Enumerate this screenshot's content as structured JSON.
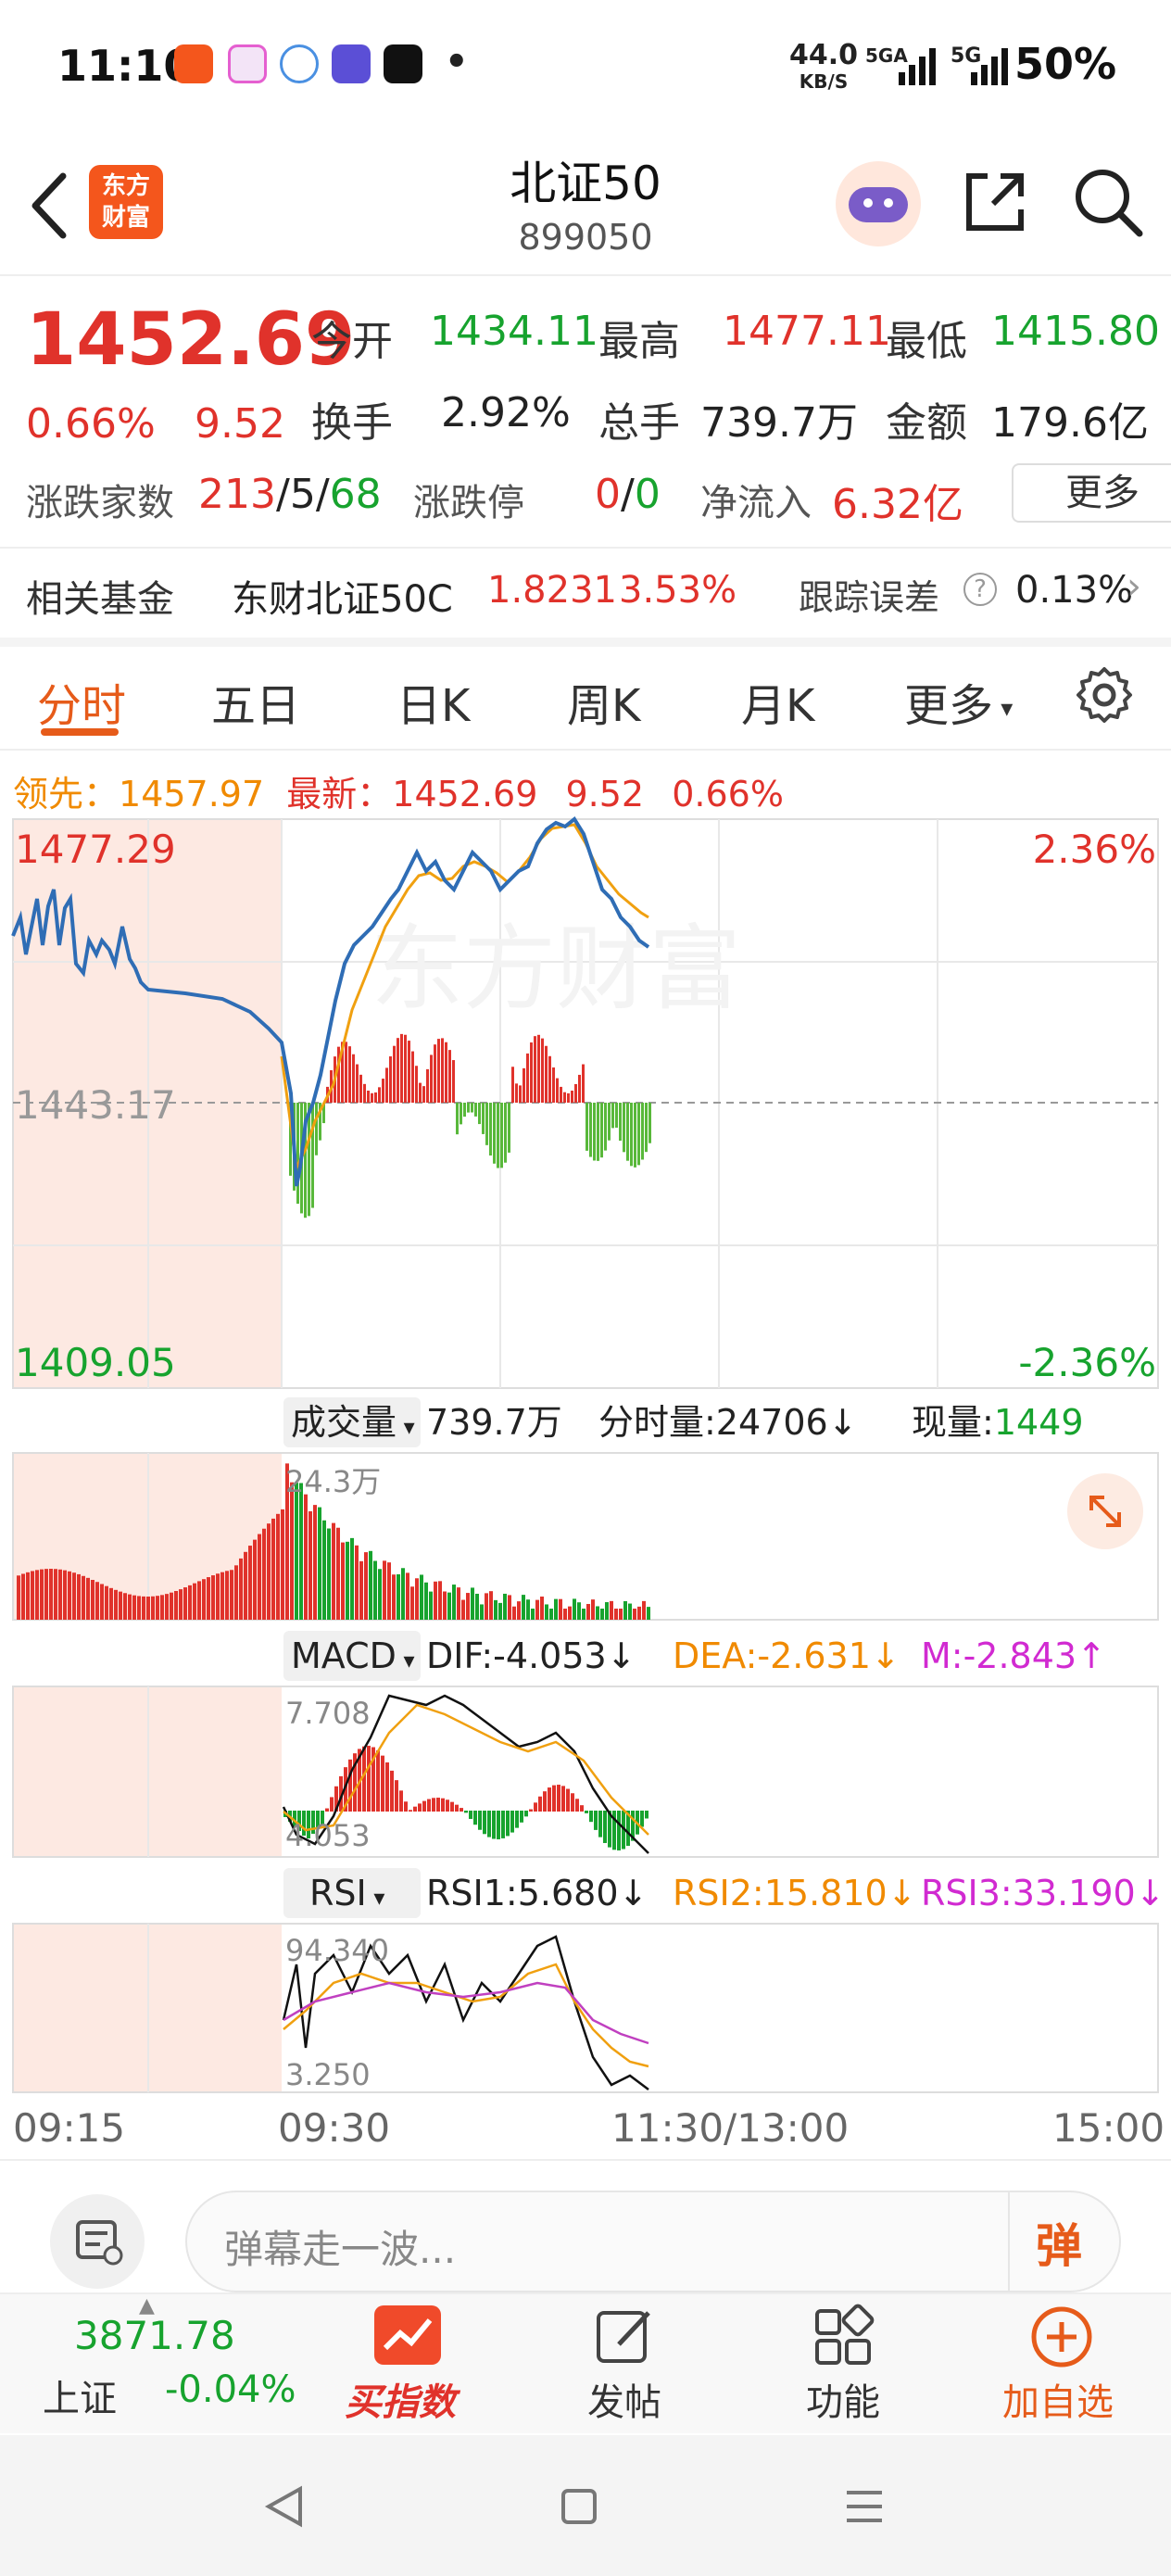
{
  "status_bar": {
    "time": "11:10",
    "net_speed": "44.0",
    "net_unit": "KB/S",
    "sig1": "5GA",
    "sig2": "5G",
    "battery": "50%",
    "dot": "•"
  },
  "header": {
    "title": "北证50",
    "code": "899050",
    "logo_line1": "东方",
    "logo_line2": "财富"
  },
  "quote": {
    "price": "1452.69",
    "pct": "0.66%",
    "change": "9.52",
    "open_label": "今开",
    "open": "1434.11",
    "high_label": "最高",
    "high": "1477.11",
    "low_label": "最低",
    "low": "1415.80",
    "turnover_label": "换手",
    "turnover": "2.92%",
    "volume_label": "总手",
    "volume": "739.7万",
    "amount_label": "金额",
    "amount": "179.6亿",
    "breadth_label": "涨跌家数",
    "breadth_up": "213",
    "breadth_sep1": "/",
    "breadth_flat": "5",
    "breadth_sep2": "/",
    "breadth_down": "68",
    "limit_label": "涨跌停",
    "limit_up": "0",
    "limit_sep": "/",
    "limit_down": "0",
    "inflow_label": "净流入",
    "inflow": "6.32亿",
    "more_label": "更多"
  },
  "fund": {
    "label": "相关基金",
    "name": "东财北证50C",
    "nav": "1.8231",
    "pct": "3.53%",
    "track_label": "跟踪误差",
    "track_value": "0.13%"
  },
  "tabs": [
    "分时",
    "五日",
    "日K",
    "周K",
    "月K",
    "更多"
  ],
  "lead": {
    "lead_label": "领先：",
    "lead_value": "1457.97",
    "latest_label": "最新：",
    "latest_value": "1452.69",
    "change": "9.52",
    "pct": "0.66%"
  },
  "chart": {
    "top_price": "1477.29",
    "mid_price": "1443.17",
    "bottom_price": "1409.05",
    "top_pct": "2.36%",
    "bottom_pct": "-2.36%",
    "watermark": "东方财富",
    "volume_label": "成交量",
    "volume_total": "739.7万",
    "tick_vol": "分时量:24706↓",
    "now_vol_label": "现量:",
    "now_vol": "1449",
    "vol_max": "24.3万",
    "macd_label": "MACD",
    "dif": "DIF:-4.053↓",
    "dea": "DEA:-2.631↓",
    "m": "M:-2.843↑",
    "macd_max": "7.708",
    "macd_min": "4.053",
    "rsi_label": "RSI",
    "rsi1": "RSI1:5.680↓",
    "rsi2": "RSI2:15.810↓",
    "rsi3": "RSI3:33.190↓",
    "rsi_max": "94.340",
    "rsi_min": "3.250",
    "times": [
      "09:15",
      "09:30",
      "11:30/13:00",
      "15:00"
    ]
  },
  "bottom": {
    "danmaku_placeholder": "弹幕走一波...",
    "danmaku_btn": "弹",
    "index_value": "3871.78",
    "index_name": "上证",
    "index_pct": "-0.04%",
    "buy_index": "买指数",
    "post": "发帖",
    "function": "功能",
    "add_fav": "加自选"
  }
}
